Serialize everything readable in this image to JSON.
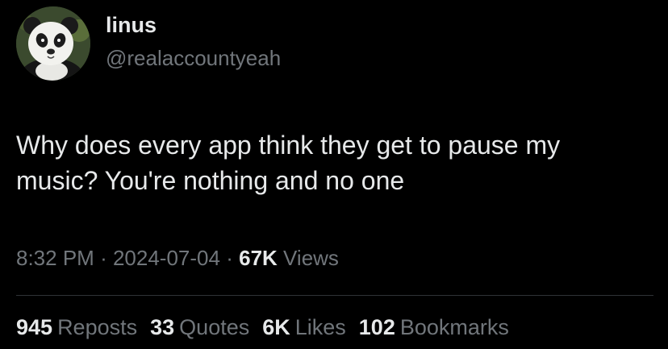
{
  "author": {
    "display_name": "linus",
    "handle": "@realaccountyeah",
    "avatar_icon": "panda-avatar-icon"
  },
  "tweet": {
    "text_lines": [
      "Why does every app think they get to pause my",
      "music? You're nothing and no one"
    ],
    "time": "8:32 PM",
    "separator": "·",
    "date": "2024-07-04",
    "views_count": "67K",
    "views_label": "Views"
  },
  "stats": [
    {
      "count": "945",
      "label": "Reposts"
    },
    {
      "count": "33",
      "label": "Quotes"
    },
    {
      "count": "6K",
      "label": "Likes"
    },
    {
      "count": "102",
      "label": "Bookmarks"
    }
  ],
  "colors": {
    "background": "#000000",
    "primary_text": "#e7e9ea",
    "secondary_text": "#71767b",
    "divider": "#2f3336"
  }
}
